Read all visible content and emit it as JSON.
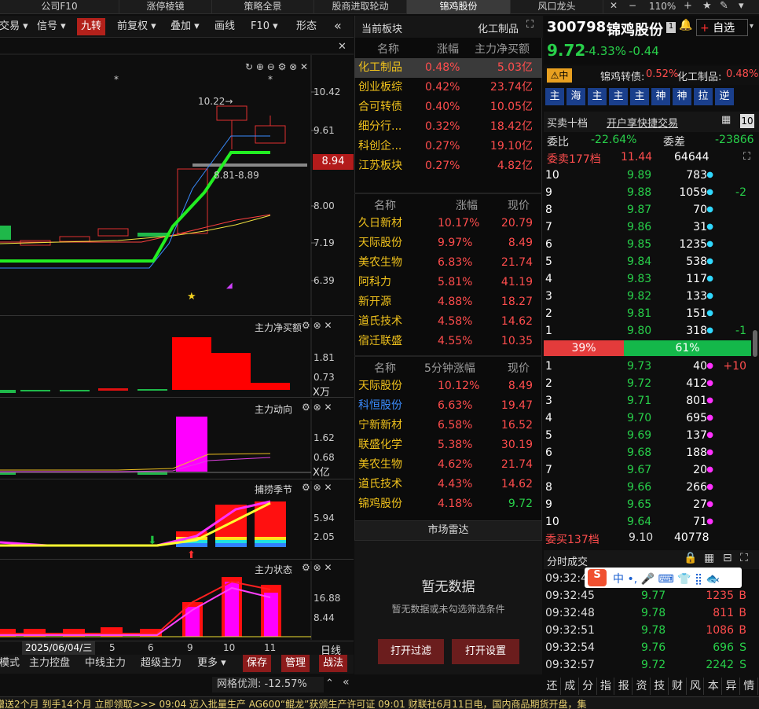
{
  "top_tabs": [
    "公司F10",
    "涨停棱镜",
    "策略全景",
    "股商进取轮动",
    "锦鸡股份",
    "风口龙头"
  ],
  "window_controls": {
    "zoom": "110%"
  },
  "toolbar": [
    "交易",
    "信号",
    "九转",
    "前复权",
    "叠加",
    "画线",
    "F10",
    "形态"
  ],
  "chart": {
    "main_labels": [
      "10.42",
      "9.61",
      "8.94",
      "8.00",
      "7.19",
      "6.39"
    ],
    "annotation_high": "10.22→",
    "annotation_range": "8.81-8.89",
    "indicators": [
      {
        "title": "主力净买额",
        "ticks": [
          "1.81",
          "0.73"
        ],
        "unit": "X万"
      },
      {
        "title": "主力动向",
        "ticks": [
          "1.62",
          "0.68"
        ],
        "unit": "X亿"
      },
      {
        "title": "捕捞季节",
        "ticks": [
          "5.94",
          "2.05"
        ]
      },
      {
        "title": "主力状态",
        "ticks": [
          "16.88",
          "8.44"
        ]
      }
    ],
    "date_cursor": "2025/06/04/三",
    "x_ticks": [
      "5",
      "6",
      "9",
      "10",
      "11"
    ],
    "period": "日线"
  },
  "bottom_tabs": [
    "模式",
    "主力控盘",
    "中线主力",
    "超级主力",
    "更多"
  ],
  "bottom_actions": [
    "保存",
    "管理",
    "战法"
  ],
  "grid_status": "网格优测: -12.57%",
  "sector_panel": {
    "title": "当前板块",
    "sector": "化工制品",
    "headers": [
      "名称",
      "涨幅",
      "主力净买额"
    ],
    "rows": [
      {
        "name": "化工制品",
        "chg": "0.48%",
        "net": "5.03亿"
      },
      {
        "name": "创业板综",
        "chg": "0.42%",
        "net": "23.74亿"
      },
      {
        "name": "合可转债",
        "chg": "0.40%",
        "net": "10.05亿"
      },
      {
        "name": "细分行...",
        "chg": "0.32%",
        "net": "18.42亿"
      },
      {
        "name": "科创企...",
        "chg": "0.27%",
        "net": "19.10亿"
      },
      {
        "name": "江苏板块",
        "chg": "0.27%",
        "net": "4.82亿"
      }
    ]
  },
  "stock_list": {
    "headers": [
      "名称",
      "涨幅",
      "现价"
    ],
    "rows": [
      {
        "name": "久日新材",
        "chg": "10.17%",
        "price": "20.79"
      },
      {
        "name": "天际股份",
        "chg": "9.97%",
        "price": "8.49"
      },
      {
        "name": "美农生物",
        "chg": "6.83%",
        "price": "21.74"
      },
      {
        "name": "阿科力",
        "chg": "5.81%",
        "price": "41.19"
      },
      {
        "name": "新开源",
        "chg": "4.88%",
        "price": "18.27"
      },
      {
        "name": "道氏技术",
        "chg": "4.58%",
        "price": "14.62"
      },
      {
        "name": "宿迁联盛",
        "chg": "4.55%",
        "price": "10.35"
      }
    ]
  },
  "five_min_list": {
    "headers": [
      "名称",
      "5分钟涨幅",
      "现价"
    ],
    "rows": [
      {
        "name": "天际股份",
        "chg": "10.12%",
        "price": "8.49"
      },
      {
        "name": "科恒股份",
        "chg": "6.63%",
        "price": "19.47"
      },
      {
        "name": "宁新新材",
        "chg": "6.58%",
        "price": "16.52"
      },
      {
        "name": "联盛化学",
        "chg": "5.38%",
        "price": "30.19"
      },
      {
        "name": "美农生物",
        "chg": "4.62%",
        "price": "21.74"
      },
      {
        "name": "道氏技术",
        "chg": "4.43%",
        "price": "14.62"
      },
      {
        "name": "锦鸡股份",
        "chg": "4.18%",
        "price": "9.72"
      }
    ]
  },
  "radar": {
    "title": "市场雷达",
    "empty_title": "暂无数据",
    "empty_desc": "暂无数据或未勾选筛选条件",
    "btn_filter": "打开过滤",
    "btn_settings": "打开设置"
  },
  "stock": {
    "code": "300798",
    "name": "锦鸡股份",
    "price": "9.72",
    "chg_pct": "-4.33%",
    "chg": "-0.44",
    "badge": "中",
    "convert_label": "锦鸡转债:",
    "convert_chg": "0.52%",
    "sector_label": "化工制品:",
    "sector_chg": "0.48%",
    "add_btn": "自选"
  },
  "tabs_row": [
    "主",
    "海",
    "主",
    "主",
    "主",
    "神",
    "神",
    "拉",
    "逆"
  ],
  "orderbook": {
    "title": "买卖十档",
    "link": "开户享快捷交易",
    "wei_bi_label": "委比",
    "wei_bi": "-22.64%",
    "wei_cha_label": "委差",
    "wei_cha": "-23866",
    "sell_total_label": "委卖177档",
    "sell_total_price": "11.44",
    "sell_total_vol": "64644",
    "sells": [
      {
        "lv": "10",
        "p": "9.89",
        "v": "783",
        "d": ""
      },
      {
        "lv": "9",
        "p": "9.88",
        "v": "1059",
        "d": "-2"
      },
      {
        "lv": "8",
        "p": "9.87",
        "v": "70",
        "d": ""
      },
      {
        "lv": "7",
        "p": "9.86",
        "v": "31",
        "d": ""
      },
      {
        "lv": "6",
        "p": "9.85",
        "v": "1235",
        "d": ""
      },
      {
        "lv": "5",
        "p": "9.84",
        "v": "538",
        "d": ""
      },
      {
        "lv": "4",
        "p": "9.83",
        "v": "117",
        "d": ""
      },
      {
        "lv": "3",
        "p": "9.82",
        "v": "133",
        "d": ""
      },
      {
        "lv": "2",
        "p": "9.81",
        "v": "151",
        "d": ""
      },
      {
        "lv": "1",
        "p": "9.80",
        "v": "318",
        "d": "-1"
      }
    ],
    "ratio_sell": "39%",
    "ratio_buy": "61%",
    "buys": [
      {
        "lv": "1",
        "p": "9.73",
        "v": "40",
        "d": "+10"
      },
      {
        "lv": "2",
        "p": "9.72",
        "v": "412",
        "d": ""
      },
      {
        "lv": "3",
        "p": "9.71",
        "v": "801",
        "d": ""
      },
      {
        "lv": "4",
        "p": "9.70",
        "v": "695",
        "d": ""
      },
      {
        "lv": "5",
        "p": "9.69",
        "v": "137",
        "d": ""
      },
      {
        "lv": "6",
        "p": "9.68",
        "v": "188",
        "d": ""
      },
      {
        "lv": "7",
        "p": "9.67",
        "v": "20",
        "d": ""
      },
      {
        "lv": "8",
        "p": "9.66",
        "v": "266",
        "d": ""
      },
      {
        "lv": "9",
        "p": "9.65",
        "v": "27",
        "d": ""
      },
      {
        "lv": "10",
        "p": "9.64",
        "v": "71",
        "d": ""
      }
    ],
    "buy_total_label": "委买137档",
    "buy_total_price": "9.10",
    "buy_total_vol": "40778"
  },
  "ticks": {
    "title": "分时成交",
    "rows": [
      {
        "t": "09:32:42",
        "p": "",
        "v": "",
        "s": ""
      },
      {
        "t": "09:32:45",
        "p": "9.77",
        "v": "1235",
        "s": "B"
      },
      {
        "t": "09:32:48",
        "p": "9.78",
        "v": "811",
        "s": "B"
      },
      {
        "t": "09:32:51",
        "p": "9.78",
        "v": "1086",
        "s": "B"
      },
      {
        "t": "09:32:54",
        "p": "9.76",
        "v": "696",
        "s": "S"
      },
      {
        "t": "09:32:57",
        "p": "9.72",
        "v": "2242",
        "s": "S"
      }
    ]
  },
  "bottom_right_tabs": [
    "还",
    "成",
    "分",
    "指",
    "报",
    "资",
    "技",
    "财",
    "风",
    "本",
    "异",
    "情"
  ],
  "ticker": "赠送2个月  到手14个月  立即领取>>>    09:04 迈入批量生产 AG600“鲲龙”获颁生产许可证    09:01 财联社6月11日电，国内商品期货开盘，集"
}
